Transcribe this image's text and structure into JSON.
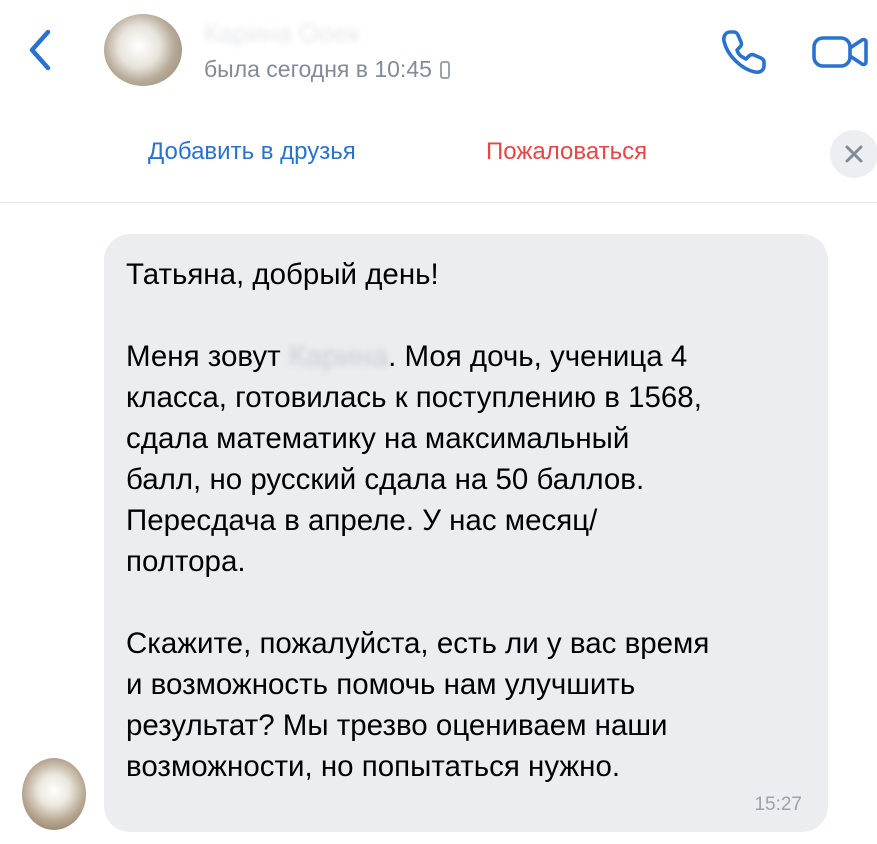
{
  "header": {
    "contact_name": "Карина Ооек",
    "last_seen": "была сегодня в 10:45",
    "icons": {
      "back": "chevron-left-icon",
      "call": "phone-icon",
      "video": "video-camera-icon",
      "device": "mobile-phone-icon"
    }
  },
  "action_bar": {
    "add_friend": "Добавить в друзья",
    "report": "Пожаловаться",
    "close_icon": "close-icon"
  },
  "message": {
    "lines": [
      "Татьяна, добрый день!",
      "",
      "Меня зовут",
      "класса, готовилась к поступлению в 1568,",
      "сдала математику на максимальный",
      "балл, но русский сдала на 50 баллов.",
      "Пересдача в апреле. У нас месяц/",
      "полтора.",
      "",
      "Скажите, пожалуйста, есть ли у вас время",
      "и возможность помочь нам улучшить",
      "результат? Мы трезво оцениваем наши",
      "возможности, но попытаться нужно."
    ],
    "hidden_name": "Карина",
    "line3_rest": ". Моя дочь, ученица 4",
    "time": "15:27"
  },
  "colors": {
    "accent": "#2a72d0",
    "danger": "#e64646",
    "bubble": "#ebedf0",
    "secondary_text": "#818c99"
  }
}
